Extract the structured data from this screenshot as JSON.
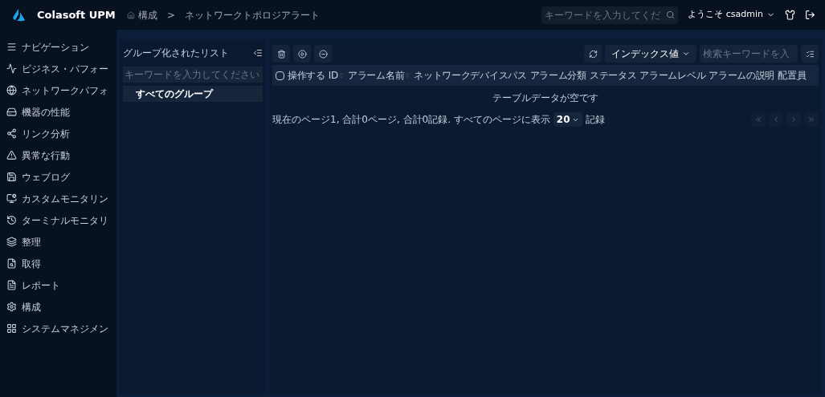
{
  "header": {
    "logo": "Colasoft UPM",
    "breadcrumb": [
      "構成",
      "ネットワークトポロジアラート"
    ],
    "separator": ">",
    "search_placeholder": "キーワードを入力してくだ",
    "user": "ようこそ csadmin"
  },
  "sidebar": {
    "items": [
      {
        "label": "ナビゲーション"
      },
      {
        "label": "ビジネス・パフォー"
      },
      {
        "label": "ネットワークパフォ"
      },
      {
        "label": "機器の性能"
      },
      {
        "label": "リンク分析"
      },
      {
        "label": "異常な行動"
      },
      {
        "label": "ウェブログ"
      },
      {
        "label": "カスタムモニタリン"
      },
      {
        "label": "ターミナルモニタリ"
      },
      {
        "label": "整理"
      },
      {
        "label": "取得"
      },
      {
        "label": "レポート"
      },
      {
        "label": "構成"
      },
      {
        "label": "システムマネジメン"
      }
    ]
  },
  "group_panel": {
    "title": "グループ化されたリスト",
    "placeholder": "キーワードを入力してください",
    "groups": [
      {
        "label": "すべてのグループ",
        "selected": true
      }
    ]
  },
  "table": {
    "index_dropdown": "インデックス値",
    "search_placeholder": "検索キーワードを入",
    "select_all_checked": false,
    "columns": [
      {
        "label": "操作する",
        "sortable": false
      },
      {
        "label": "ID",
        "sortable": true
      },
      {
        "label": "アラーム名前",
        "sortable": true
      },
      {
        "label": "ネットワークデバイスパス",
        "sortable": false
      },
      {
        "label": "アラーム分類",
        "sortable": false
      },
      {
        "label": "ステータス",
        "sortable": false
      },
      {
        "label": "アラームレベル",
        "sortable": false
      },
      {
        "label": "アラームの説明",
        "sortable": false
      },
      {
        "label": "配置員",
        "sortable": false
      }
    ],
    "empty_text": "テーブルデータが空です"
  },
  "pagination": {
    "summary": "現在のページ1, 合計0ページ, 合計0記録. すべてのページに表示",
    "page_size": "20",
    "suffix": "記録"
  }
}
